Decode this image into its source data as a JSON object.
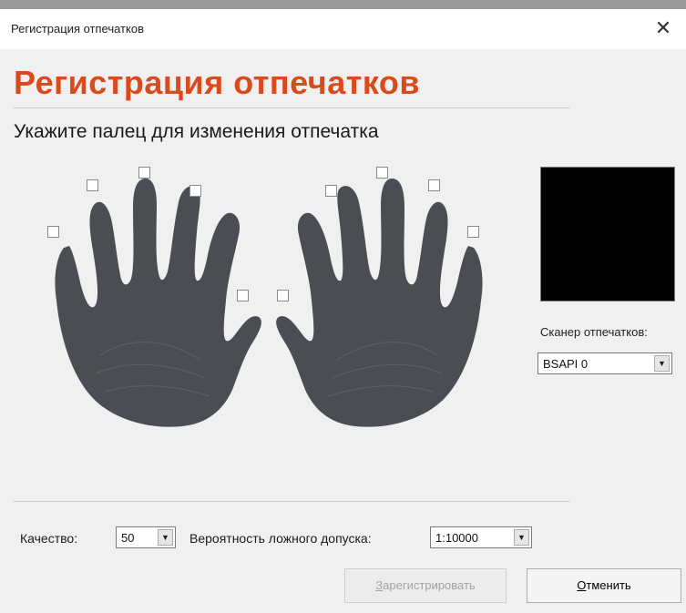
{
  "window": {
    "title": "Регистрация отпечатков",
    "close_glyph": "✕"
  },
  "header": {
    "heading": "Регистрация отпечатков",
    "heading_color": "#d94a1c",
    "instruction": "Укажите палец для изменения отпечатка"
  },
  "scanner": {
    "label": "Сканер отпечатков:",
    "selected": "BSAPI 0"
  },
  "settings": {
    "quality_label": "Качество:",
    "quality_value": "50",
    "far_label": "Вероятность ложного допуска:",
    "far_value": "1:10000"
  },
  "buttons": {
    "register_first": "З",
    "register_rest": "арегистрировать",
    "cancel_first": "О",
    "cancel_rest": "тменить"
  },
  "icons": {
    "dropdown": "▼"
  }
}
